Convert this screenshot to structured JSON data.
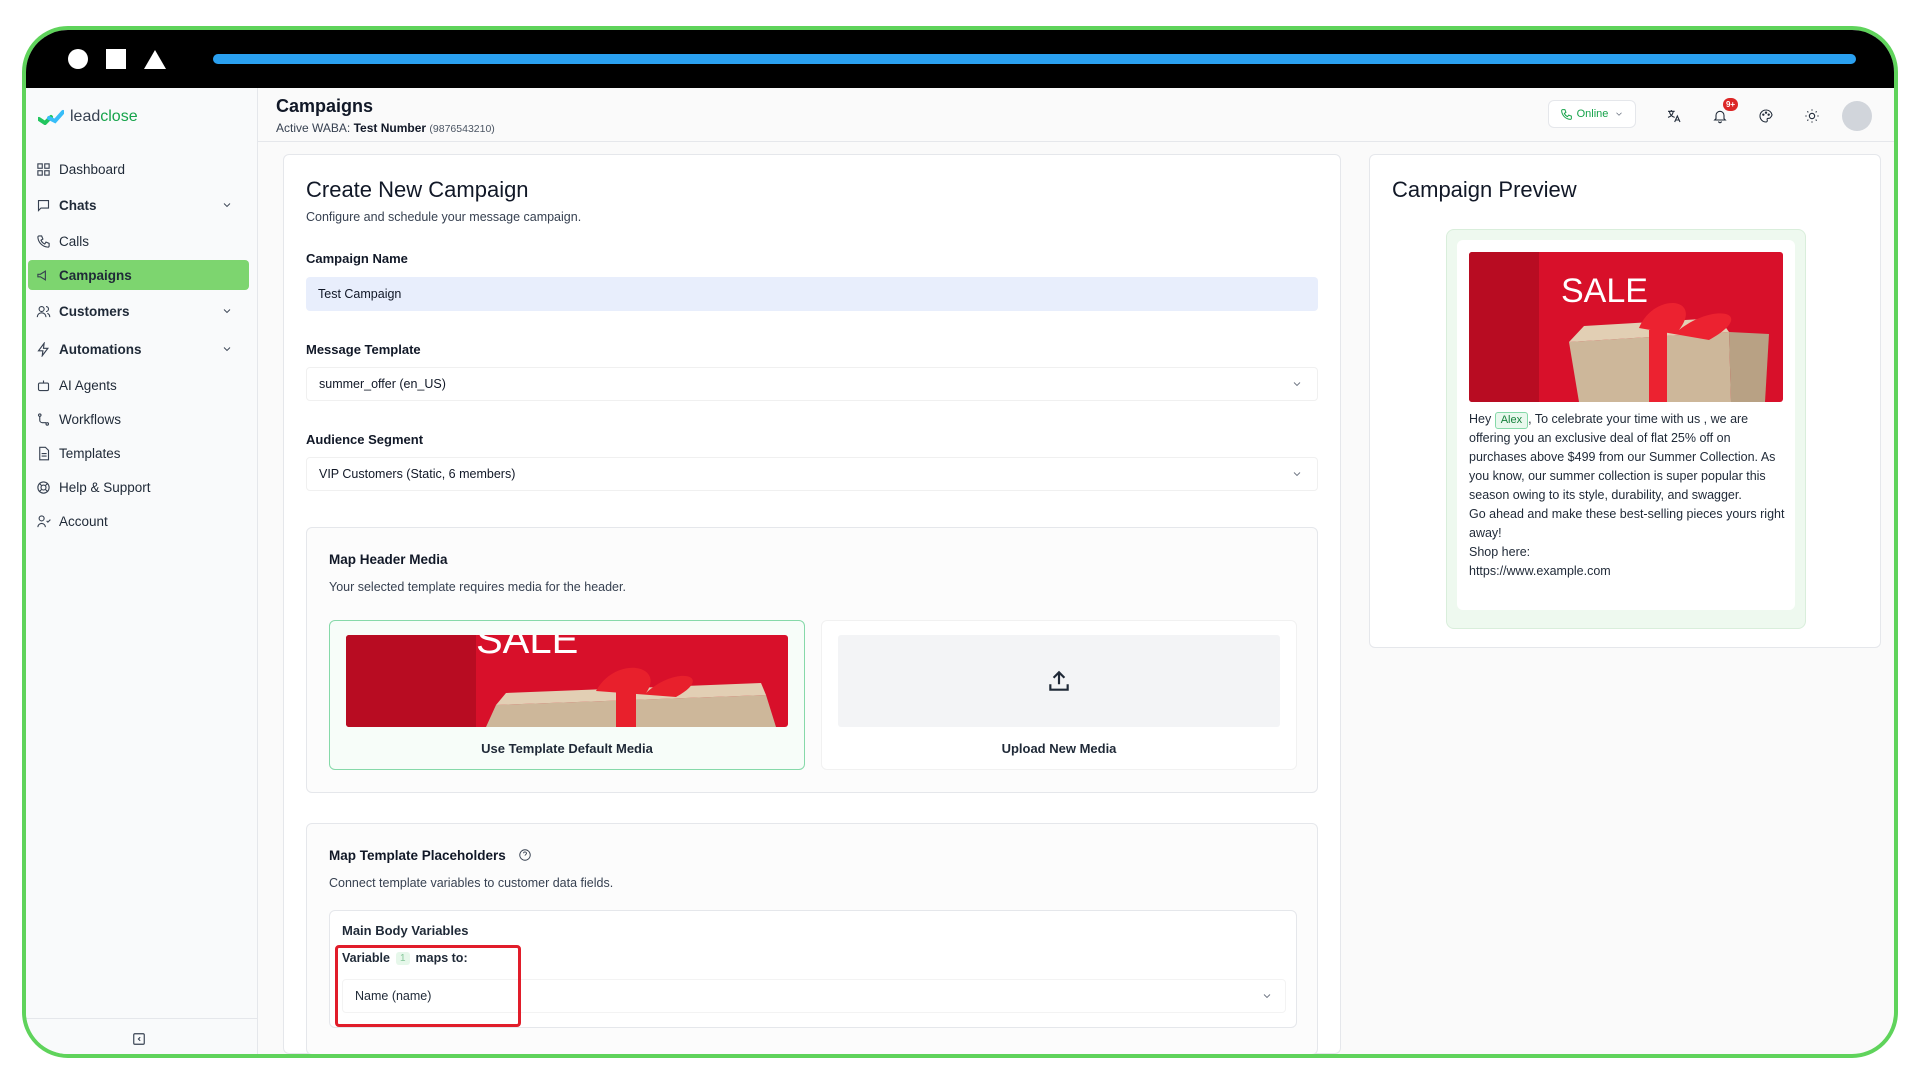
{
  "app": {
    "brand_part1": "lead",
    "brand_part2": "close",
    "page_title": "Campaigns",
    "waba_label": "Active WABA:",
    "waba_name": "Test Number",
    "waba_number": "(9876543210)",
    "status": "Online",
    "notification_count": "9+",
    "progress_fraction": 1.0
  },
  "sidebar": {
    "items": [
      {
        "label": "Dashboard",
        "icon": "dashboard-icon"
      },
      {
        "label": "Chats",
        "icon": "chat-icon",
        "expandable": true
      },
      {
        "label": "Calls",
        "icon": "phone-icon"
      },
      {
        "label": "Campaigns",
        "icon": "megaphone-icon",
        "active": true
      },
      {
        "label": "Customers",
        "icon": "users-icon",
        "expandable": true
      },
      {
        "label": "Automations",
        "icon": "zap-icon",
        "expandable": true
      },
      {
        "label": "AI Agents",
        "icon": "bot-icon"
      },
      {
        "label": "Workflows",
        "icon": "workflow-icon"
      },
      {
        "label": "Templates",
        "icon": "file-icon"
      },
      {
        "label": "Help & Support",
        "icon": "lifebuoy-icon"
      },
      {
        "label": "Account",
        "icon": "user-icon"
      }
    ]
  },
  "form": {
    "title": "Create New Campaign",
    "subtitle": "Configure and schedule your message campaign.",
    "campaign_name_label": "Campaign Name",
    "campaign_name_value": "Test Campaign",
    "template_label": "Message Template",
    "template_value": "summer_offer (en_US)",
    "audience_label": "Audience Segment",
    "audience_value": "VIP Customers (Static, 6 members)",
    "header_media": {
      "title": "Map Header Media",
      "description": "Your selected template requires media for the header.",
      "option_default": "Use Template Default Media",
      "option_upload": "Upload New Media",
      "image_text": "SALE"
    },
    "placeholders": {
      "title": "Map Template Placeholders",
      "description": "Connect template variables to customer data fields.",
      "section_title": "Main Body Variables",
      "variable_prefix": "Variable",
      "variable_number": "1",
      "variable_suffix": "maps to:",
      "mapped_value": "Name (name)"
    }
  },
  "preview": {
    "title": "Campaign Preview",
    "image_text": "SALE",
    "greeting": "Hey",
    "name_chip": "Alex",
    "line1": ", To celebrate your time with us , we are offering you an exclusive deal of flat 25% off on purchases above $499 from our Summer Collection. As you know, our summer collection is super popular this season owing to its style, durability, and swagger.",
    "line2": "Go ahead and make these best-selling pieces yours right away!",
    "line3": "Shop here:",
    "line4": "https://www.example.com"
  },
  "colors": {
    "accent_green": "#7dd56f",
    "frame_green": "#5fd35b",
    "progress_blue": "#2aa0f0",
    "highlight_red": "#e11d2a"
  }
}
